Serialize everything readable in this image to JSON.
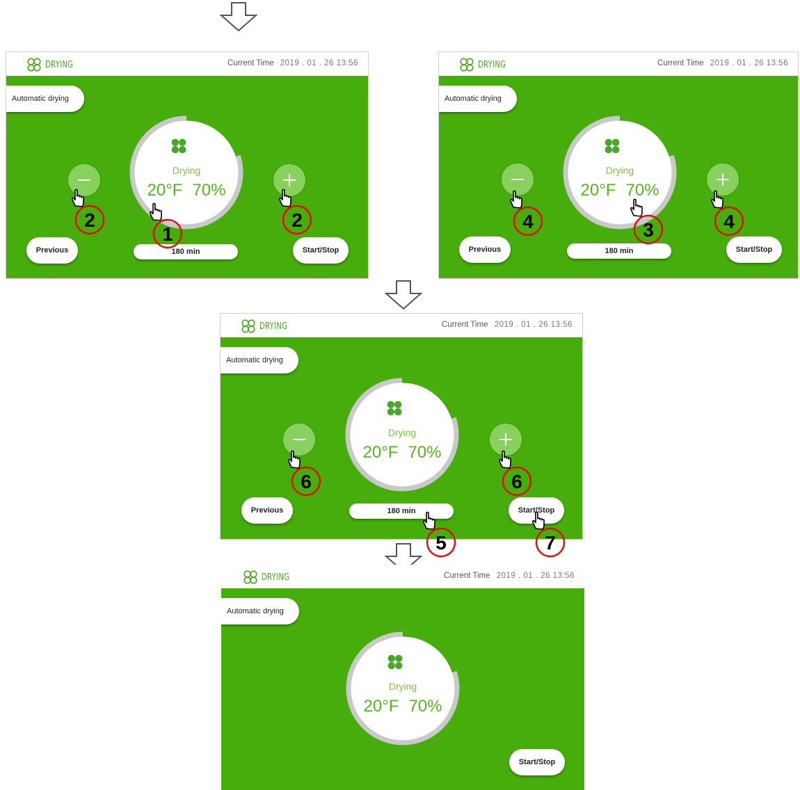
{
  "header": {
    "brand": "DRYING",
    "time_label": "Current Time",
    "time_value": "2019 . 01 . 26  13:56"
  },
  "mode_label": "Automatic drying",
  "buttons": {
    "previous": "Previous",
    "start_stop": "Start/Stop"
  },
  "dial": {
    "status": "Drying",
    "temperature": "20°F",
    "humidity": "70%",
    "progress": 0.2
  },
  "timer": "180 min",
  "icons": {
    "brand": "fan-icon",
    "arrow": "down-arrow-icon",
    "pointer": "hand-pointer-icon"
  },
  "colors": {
    "background": "#46ad0c",
    "accent": "#57b51e",
    "marker": "#e01010"
  },
  "step_markers": {
    "screen1": {
      "dial": "1",
      "minus": "2",
      "plus": "2"
    },
    "screen2": {
      "dial": "3",
      "minus": "4",
      "plus": "4"
    },
    "screen3": {
      "timer": "5",
      "minus": "6",
      "plus": "6",
      "start": "7"
    }
  }
}
